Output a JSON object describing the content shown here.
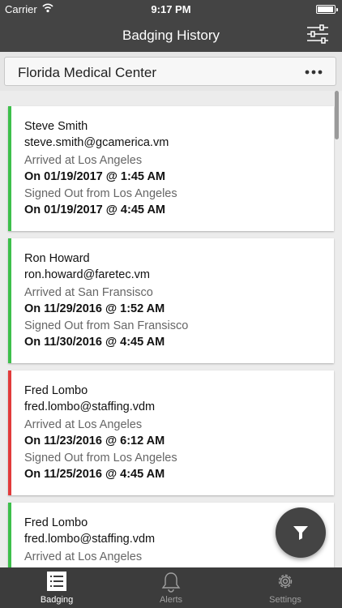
{
  "status_bar": {
    "carrier": "Carrier",
    "time": "9:17 PM"
  },
  "nav": {
    "title": "Badging History",
    "filters_icon": "sliders-icon"
  },
  "facility": {
    "name": "Florida Medical Center",
    "menu_icon": "more-dots-icon"
  },
  "entries": [
    {
      "name": "Steve Smith",
      "email": "steve.smith@gcamerica.vm",
      "arrived_label": "Arrived at Los Angeles",
      "arrived_time": "On 01/19/2017 @ 1:45 AM",
      "signed_out_label": "Signed Out from Los Angeles",
      "signed_out_time": "On 01/19/2017 @ 4:45 AM",
      "status_color": "#3cbf4a"
    },
    {
      "name": "Ron Howard",
      "email": "ron.howard@faretec.vm",
      "arrived_label": "Arrived at San Fransisco",
      "arrived_time": "On 11/29/2016 @ 1:52 AM",
      "signed_out_label": "Signed Out from San Fransisco",
      "signed_out_time": "On 11/30/2016 @ 4:45 AM",
      "status_color": "#3cbf4a"
    },
    {
      "name": "Fred Lombo",
      "email": "fred.lombo@staffing.vdm",
      "arrived_label": "Arrived at Los Angeles",
      "arrived_time": "On 11/23/2016 @ 6:12 AM",
      "signed_out_label": "Signed Out from Los Angeles",
      "signed_out_time": "On 11/25/2016 @ 4:45 AM",
      "status_color": "#e23a3a"
    },
    {
      "name": "Fred Lombo",
      "email": "fred.lombo@staffing.vdm",
      "arrived_label": "Arrived at Los Angeles",
      "arrived_time": "",
      "signed_out_label": "",
      "signed_out_time": "",
      "status_color": "#3cbf4a"
    }
  ],
  "fab": {
    "icon": "filter-funnel-icon"
  },
  "tabs": [
    {
      "label": "Badging",
      "icon": "list-icon",
      "active": true
    },
    {
      "label": "Alerts",
      "icon": "bell-icon",
      "active": false
    },
    {
      "label": "Settings",
      "icon": "gear-icon",
      "active": false
    }
  ]
}
